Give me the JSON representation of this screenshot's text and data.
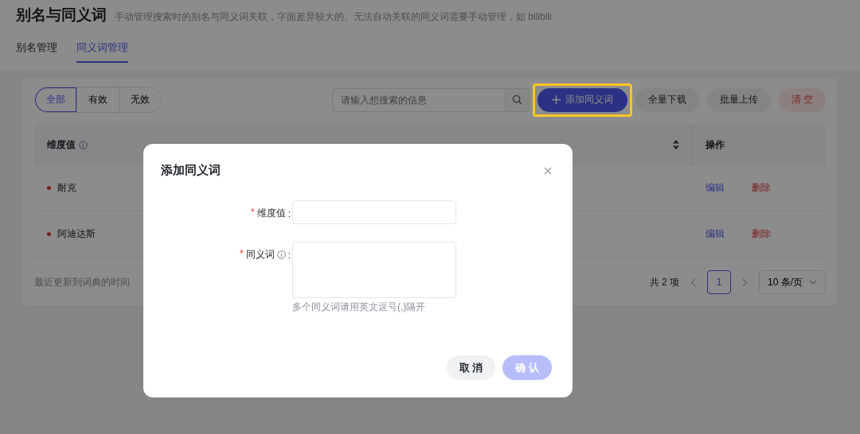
{
  "page": {
    "title": "别名与同义词",
    "description": "手动管理搜索时的别名与同义词关联，字面差异较大的、无法自动关联的同义词需要手动管理，如 bilibili"
  },
  "tabs": [
    {
      "label": "别名管理",
      "selected": false
    },
    {
      "label": "同义词管理",
      "selected": true
    }
  ],
  "filters": [
    {
      "label": "全部",
      "selected": true
    },
    {
      "label": "有效",
      "selected": false
    },
    {
      "label": "无效",
      "selected": false
    }
  ],
  "search": {
    "placeholder": "请输入想搜索的信息"
  },
  "actions": [
    {
      "label": "添加同义词",
      "kind": "primary",
      "highlighted": true
    },
    {
      "label": "全量下载",
      "kind": "default",
      "highlighted": false
    },
    {
      "label": "批量上传",
      "kind": "default",
      "highlighted": false
    },
    {
      "label": "清 空",
      "kind": "danger",
      "highlighted": false
    }
  ],
  "table": {
    "columns": [
      {
        "label": "维度值",
        "info": true
      },
      {
        "label": "操作",
        "info": false
      }
    ],
    "rows": [
      {
        "value": "耐克",
        "actions": [
          "编辑",
          "删除"
        ]
      },
      {
        "value": "阿迪达斯",
        "actions": [
          "编辑",
          "删除"
        ]
      }
    ]
  },
  "footer": {
    "updated_label": "最近更新到词典的时间",
    "total": "共 2 项",
    "pages": [
      {
        "label": "1",
        "selected": true
      }
    ],
    "page_size": "10 条/页"
  },
  "dialog": {
    "title": "添加同义词",
    "fields": [
      {
        "label": "维度值",
        "required_mark": "*",
        "colon": ":",
        "info": false,
        "kind": "input"
      },
      {
        "label": "同义词",
        "required_mark": "*",
        "colon": ":",
        "info": true,
        "kind": "textarea",
        "hint": "多个同义词请用英文逗号(,)隔开"
      }
    ],
    "buttons": [
      {
        "label": "取 消",
        "kind": "default"
      },
      {
        "label": "确 认",
        "kind": "primary",
        "disabled": true
      }
    ]
  }
}
